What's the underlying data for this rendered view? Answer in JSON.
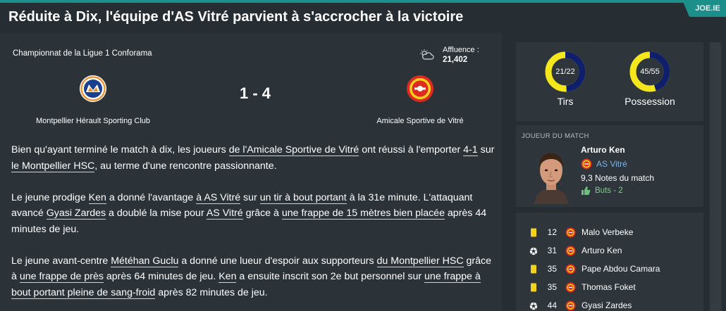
{
  "header": {
    "headline": "Réduite à Dix, l'équipe d'AS Vitré parvient à s'accrocher à la victoire",
    "source_tag": "JOE.IE",
    "accent_color": "#1d8f8a"
  },
  "match": {
    "competition": "Championnat de la Ligue 1 Conforama",
    "attendance_label": "Affluence :",
    "attendance_value": "21,402",
    "score": "1 - 4",
    "home_team": "Montpellier Hérault Sporting Club",
    "away_team": "Amicale Sportive de Vitré",
    "weather_icon": "cloud-sun-icon"
  },
  "article": {
    "p1": [
      {
        "t": "Bien qu'ayant terminé le match à dix, les joueurs "
      },
      {
        "t": "de l'Amicale Sportive de Vitré",
        "link": true
      },
      {
        "t": " ont réussi à l'emporter "
      },
      {
        "t": "4-1",
        "link": true
      },
      {
        "t": " sur "
      },
      {
        "t": "le Montpellier HSC",
        "link": true
      },
      {
        "t": ", au terme d'une rencontre passionnante."
      }
    ],
    "p2": [
      {
        "t": "Le jeune prodige "
      },
      {
        "t": "Ken",
        "link": true
      },
      {
        "t": " a donné l'avantage "
      },
      {
        "t": "à AS Vitré",
        "link": true
      },
      {
        "t": " sur "
      },
      {
        "t": "un tir à bout portant",
        "link": true
      },
      {
        "t": " à la 31e minute. L'attaquant avancé "
      },
      {
        "t": "Gyasi Zardes",
        "link": true
      },
      {
        "t": " a doublé la mise pour "
      },
      {
        "t": "AS Vitré",
        "link": true
      },
      {
        "t": " grâce à "
      },
      {
        "t": "une frappe de 15 mètres bien placée",
        "link": true
      },
      {
        "t": " après 44 minutes de jeu."
      }
    ],
    "p3": [
      {
        "t": "Le jeune avant-centre "
      },
      {
        "t": "Météhan Guclu",
        "link": true
      },
      {
        "t": " a donné une lueur d'espoir aux supporteurs "
      },
      {
        "t": "du Montpellier HSC",
        "link": true
      },
      {
        "t": " grâce à "
      },
      {
        "t": "une frappe de près",
        "link": true
      },
      {
        "t": " après 64 minutes de jeu. "
      },
      {
        "t": "Ken",
        "link": true
      },
      {
        "t": " a ensuite inscrit son 2e but personnel sur "
      },
      {
        "t": "une frappe à bout portant pleine de sang-froid",
        "link": true
      },
      {
        "t": " après 82 minutes de jeu."
      }
    ]
  },
  "stats": {
    "shots": {
      "value": "21/22",
      "label": "Tirs",
      "home": 21,
      "away": 22
    },
    "possession": {
      "value": "45/55",
      "label": "Possession",
      "home": 45,
      "away": 55
    },
    "home_color": "#0f1f6b",
    "away_color": "#f4e81c"
  },
  "potm": {
    "title": "JOUEUR DU MATCH",
    "name": "Arturo Ken",
    "club": "AS Vitré",
    "rating": "9,3 Notes du match",
    "goals": "Buts - 2"
  },
  "events": [
    {
      "type": "yellow-card",
      "minute": "12",
      "player": "Malo Verbeke"
    },
    {
      "type": "goal",
      "minute": "31",
      "player": "Arturo Ken"
    },
    {
      "type": "yellow-card",
      "minute": "35",
      "player": "Pape Abdou Camara"
    },
    {
      "type": "yellow-card",
      "minute": "35",
      "player": "Thomas Foket"
    },
    {
      "type": "goal",
      "minute": "44",
      "player": "Gyasi Zardes"
    }
  ]
}
